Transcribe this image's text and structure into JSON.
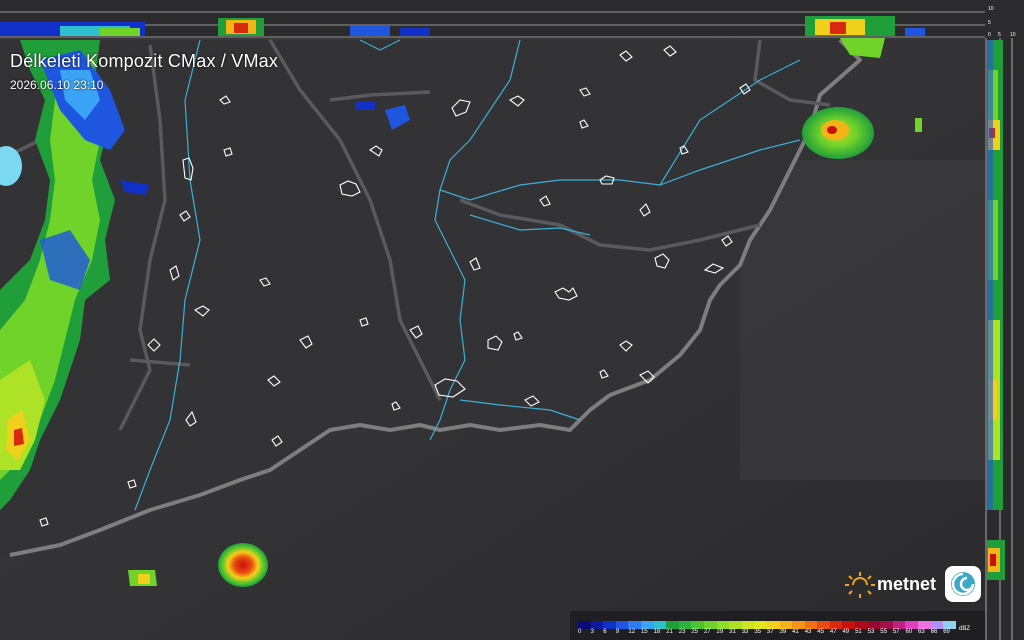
{
  "title": "Délkeleti Kompozit CMax / VMax",
  "timestamp": "2026.06.10 23:10",
  "brand": {
    "name": "metnet",
    "sun_icon": "sun-icon",
    "app_icon": "swirl-icon"
  },
  "legend": {
    "unit": "dBZ",
    "labels": [
      "0",
      "3",
      "6",
      "9",
      "12",
      "15",
      "18",
      "21",
      "23",
      "25",
      "27",
      "29",
      "31",
      "33",
      "35",
      "37",
      "39",
      "41",
      "43",
      "45",
      "47",
      "49",
      "51",
      "53",
      "55",
      "57",
      "60",
      "63",
      "66",
      "69"
    ],
    "colors": [
      "#0a0a78",
      "#0b1a9e",
      "#1030c8",
      "#1e56e0",
      "#2e7cf0",
      "#3aa3f5",
      "#2fc0d0",
      "#1f9e3a",
      "#2bb23a",
      "#4cc42e",
      "#6fd32a",
      "#8fdc28",
      "#aee226",
      "#c9e622",
      "#e2e41e",
      "#f0d01a",
      "#f4b418",
      "#f49416",
      "#f07012",
      "#e84a10",
      "#d8280e",
      "#c8100c",
      "#b00a18",
      "#98082a",
      "#a0104a",
      "#c02080",
      "#e040c0",
      "#f070e0",
      "#b090f0",
      "#90d0f0"
    ]
  },
  "top_profile_ticks": [
    "10",
    "5",
    "0",
    "5",
    "10"
  ],
  "side_profile_ticks": [
    "0",
    "5",
    "10"
  ],
  "colors": {
    "map_bg": "#2e2e31",
    "border": "#8c8c8c",
    "river": "#3ab0d8",
    "lake": "#7ad8f0"
  }
}
